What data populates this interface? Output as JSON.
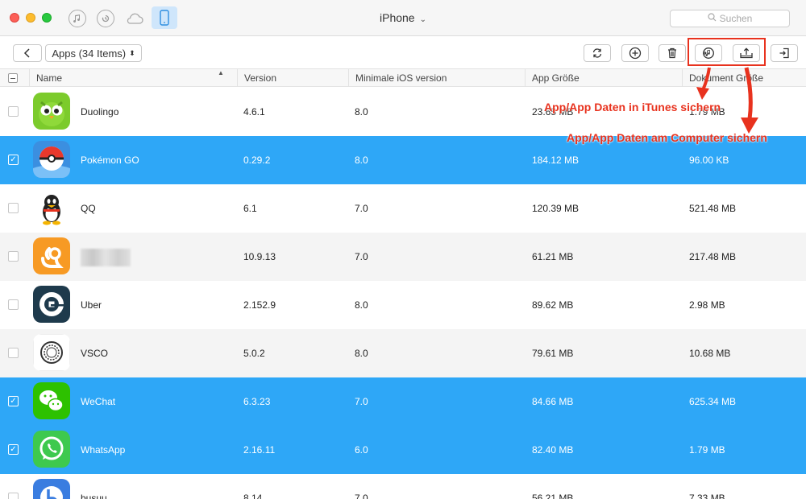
{
  "window": {
    "title": "iPhone",
    "search_placeholder": "Suchen"
  },
  "titlebar_icons": [
    "music-icon",
    "history-icon",
    "cloud-icon",
    "device-icon"
  ],
  "toolbar": {
    "apps_select": "Apps (34 Items)"
  },
  "table": {
    "headers": {
      "name": "Name",
      "version": "Version",
      "min_ios": "Minimale iOS version",
      "app_size": "App Größe",
      "doc_size": "Dokument Größe"
    },
    "rows": [
      {
        "name": "Duolingo",
        "version": "4.6.1",
        "min_ios": "8.0",
        "app_size": "23.65 MB",
        "doc_size": "1.79 MB",
        "checked": false
      },
      {
        "name": "Pokémon GO",
        "version": "0.29.2",
        "min_ios": "8.0",
        "app_size": "184.12 MB",
        "doc_size": "96.00 KB",
        "checked": true
      },
      {
        "name": "QQ",
        "version": "6.1",
        "min_ios": "7.0",
        "app_size": "120.39 MB",
        "doc_size": "521.48 MB",
        "checked": false
      },
      {
        "name": "",
        "version": "10.9.13",
        "min_ios": "7.0",
        "app_size": "61.21 MB",
        "doc_size": "217.48 MB",
        "checked": false
      },
      {
        "name": "Uber",
        "version": "2.152.9",
        "min_ios": "8.0",
        "app_size": "89.62 MB",
        "doc_size": "2.98 MB",
        "checked": false
      },
      {
        "name": "VSCO",
        "version": "5.0.2",
        "min_ios": "8.0",
        "app_size": "79.61 MB",
        "doc_size": "10.68 MB",
        "checked": false
      },
      {
        "name": "WeChat",
        "version": "6.3.23",
        "min_ios": "7.0",
        "app_size": "84.66 MB",
        "doc_size": "625.34 MB",
        "checked": true
      },
      {
        "name": "WhatsApp",
        "version": "2.16.11",
        "min_ios": "6.0",
        "app_size": "82.40 MB",
        "doc_size": "1.79 MB",
        "checked": true
      },
      {
        "name": "busuu",
        "version": "8.14",
        "min_ios": "7.0",
        "app_size": "56.21 MB",
        "doc_size": "7.33 MB",
        "checked": false
      }
    ]
  },
  "annotations": {
    "itunes": "App/App Daten in iTunes sichern",
    "computer": "App/App Daten am Computer sichern"
  },
  "colors": {
    "selection": "#2ea7f7",
    "annotation": "#e8321e"
  }
}
